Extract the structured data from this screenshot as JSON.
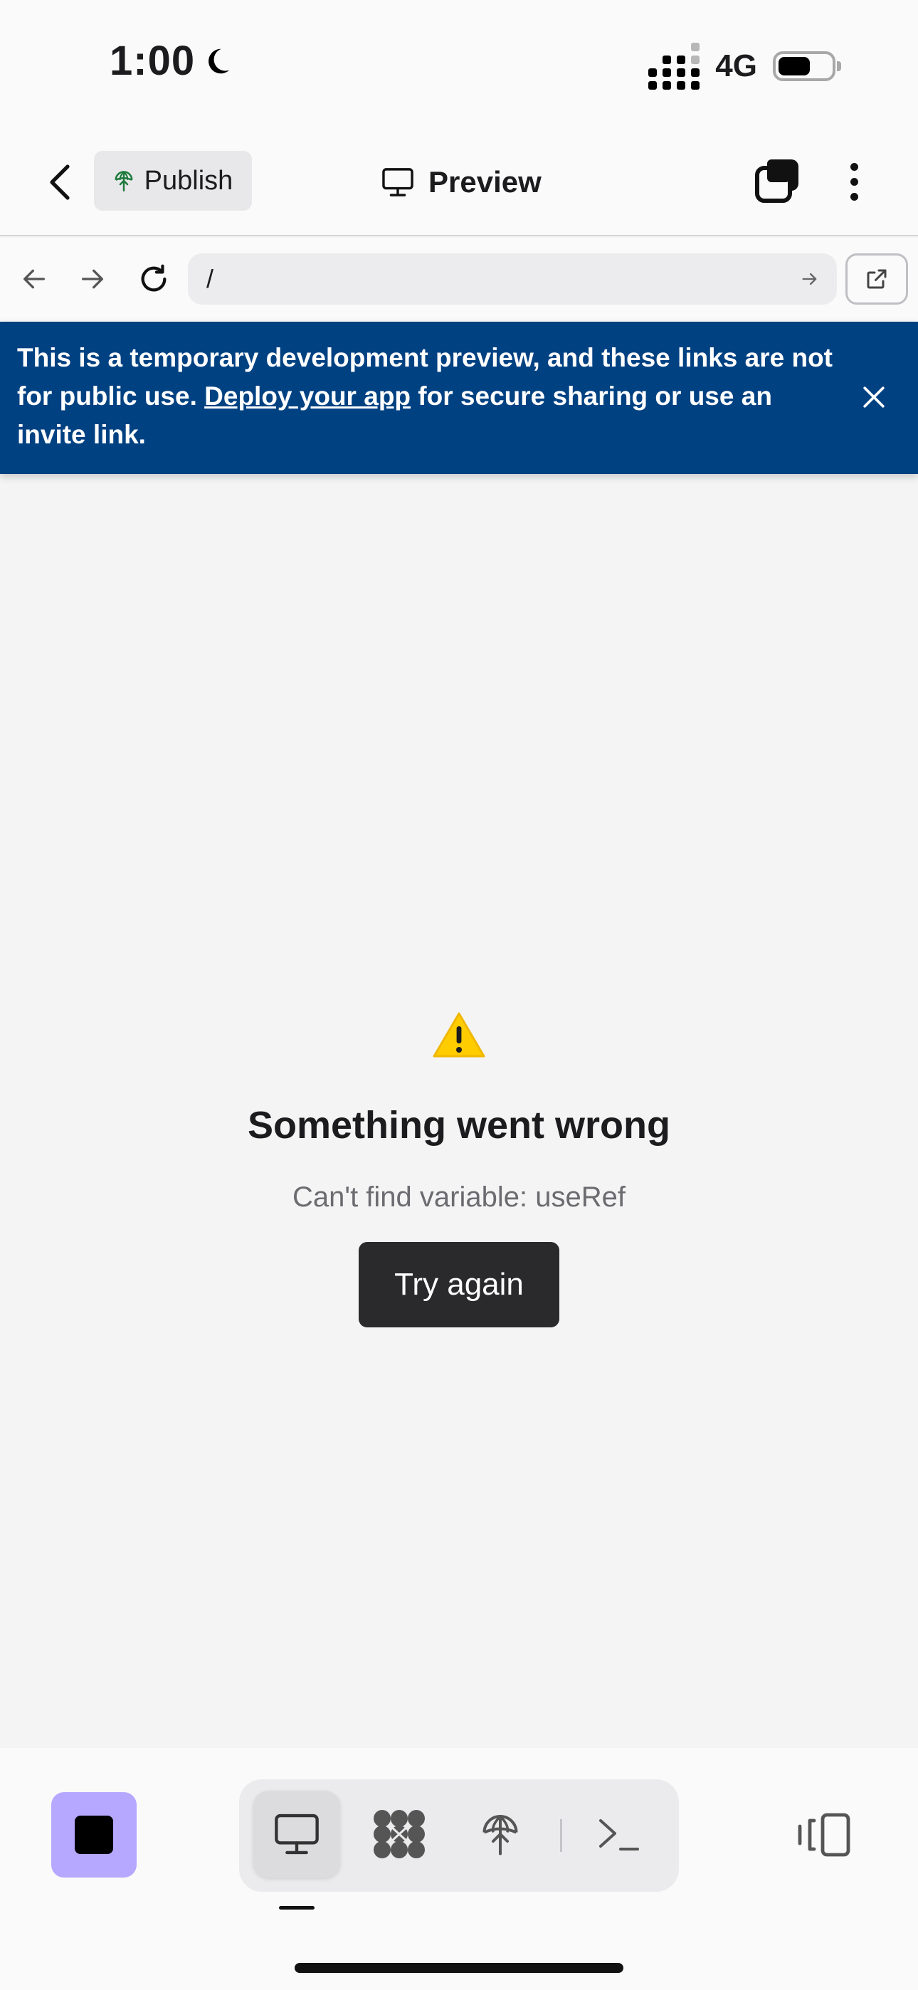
{
  "status_bar": {
    "time": "1:00",
    "network": "4G",
    "moon_icon": "moon-icon",
    "battery_level": 0.55
  },
  "top_nav": {
    "back_icon": "chevron-left-icon",
    "publish_label": "Publish",
    "publish_icon": "globe-upload-icon",
    "title": "Preview",
    "title_icon": "monitor-icon",
    "tabs_icon": "tabs-icon",
    "more_icon": "more-vertical-icon"
  },
  "url_bar": {
    "back_icon": "arrow-left-icon",
    "forward_icon": "arrow-right-icon",
    "reload_icon": "reload-icon",
    "url": "/",
    "go_icon": "arrow-right-small-icon",
    "external_icon": "external-link-icon"
  },
  "banner": {
    "text_before": "This is a temporary development preview, and these links are not for public use. ",
    "link_text": "Deploy your app",
    "text_after": " for secure sharing or use an invite link.",
    "close_icon": "close-icon",
    "background": "#004182"
  },
  "error": {
    "icon": "warning-icon",
    "title": "Something went wrong",
    "message": "Can't find variable: useRef",
    "retry_label": "Try again"
  },
  "bottom_bar": {
    "stop_icon": "stop-icon",
    "tools": [
      {
        "name": "preview-tool",
        "icon": "monitor-icon",
        "active": true
      },
      {
        "name": "packages-tool",
        "icon": "packages-icon",
        "active": false
      },
      {
        "name": "deploy-tool",
        "icon": "globe-upload-icon",
        "active": false
      },
      {
        "name": "console-tool",
        "icon": "terminal-icon",
        "active": false
      }
    ],
    "layout_icon": "split-view-icon",
    "accent": "#b6a7ff"
  }
}
